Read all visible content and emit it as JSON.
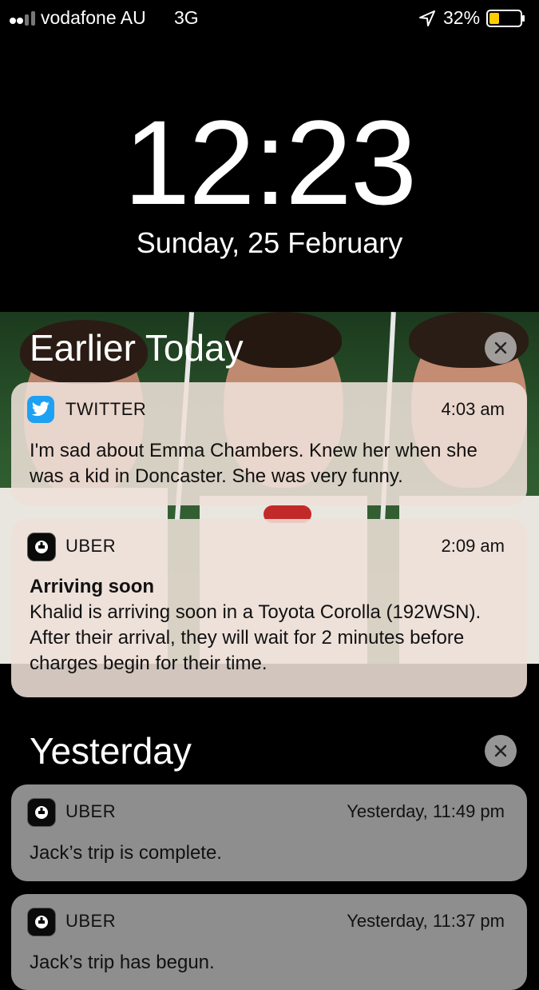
{
  "status_bar": {
    "carrier": "vodafone AU",
    "network": "3G",
    "battery_percent": "32%",
    "battery_level": 0.32,
    "battery_color": "#ffcc00",
    "icons": [
      "signal-icon",
      "location-arrow-icon",
      "battery-icon"
    ]
  },
  "lock_screen": {
    "time": "12:23",
    "date": "Sunday, 25 February"
  },
  "sections": [
    {
      "title": "Earlier Today",
      "clear_icon": "close-icon",
      "notifications": [
        {
          "app": "TWITTER",
          "icon": "twitter-bird-icon",
          "icon_color": "#1da1f2",
          "time": "4:03 am",
          "title": "",
          "body": "I'm sad about Emma Chambers. Knew her when she was a kid in Doncaster. She was very funny."
        },
        {
          "app": "UBER",
          "icon": "uber-icon",
          "time": "2:09 am",
          "title": "Arriving soon",
          "body": "Khalid is arriving soon in a Toyota Corolla (192WSN). After their arrival, they will wait for 2 minutes before charges begin for their time."
        }
      ]
    },
    {
      "title": "Yesterday",
      "clear_icon": "close-icon",
      "notifications": [
        {
          "app": "UBER",
          "icon": "uber-icon",
          "time": "Yesterday, 11:49 pm",
          "title": "",
          "body": "Jack’s trip is complete."
        },
        {
          "app": "UBER",
          "icon": "uber-icon",
          "time": "Yesterday, 11:37 pm",
          "title": "",
          "body": "Jack’s trip has begun."
        }
      ]
    }
  ]
}
